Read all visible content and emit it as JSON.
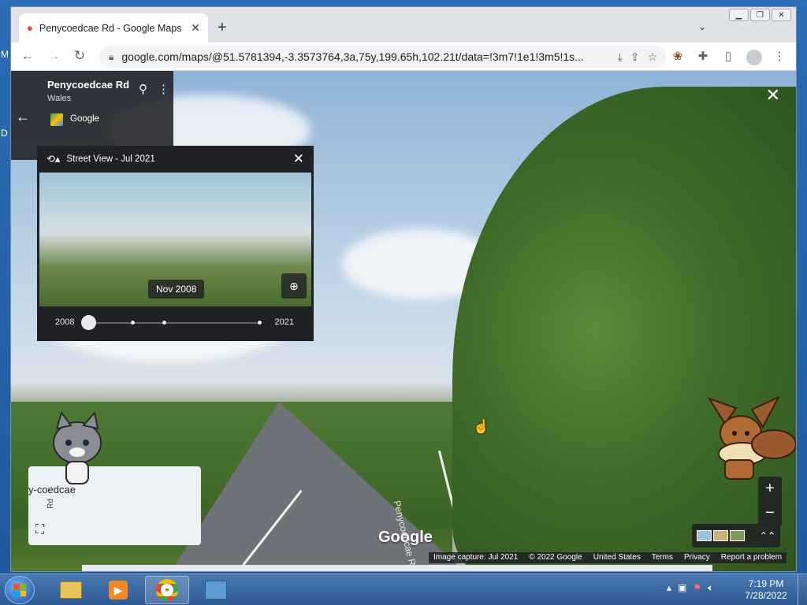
{
  "browser": {
    "tab_title": "Penycoedcae Rd - Google Maps",
    "url": "google.com/maps/@51.5781394,-3.3573764,3a,75y,199.65h,102.21t/data=!3m7!1e1!3m5!1s..."
  },
  "street_view": {
    "place_title": "Penycoedcae Rd",
    "place_subtitle": "Wales",
    "provider": "Google",
    "timeline": {
      "label": "Street View - Jul 2021",
      "selected_date": "Nov 2008",
      "start_year": "2008",
      "end_year": "2021"
    },
    "minimap": {
      "place_label": "y-coedcae",
      "road_label": "Rd"
    },
    "watermark": "Google",
    "road_marking": "Penycoedcae Rd",
    "attribution": [
      "Image capture: Jul 2021",
      "© 2022 Google",
      "United States",
      "Terms",
      "Privacy",
      "Report a problem"
    ]
  },
  "taskbar": {
    "clock_time": "7:19 PM",
    "clock_date": "7/28/2022"
  },
  "desktop": {
    "letters": [
      "M",
      "D"
    ]
  },
  "colors": {
    "panel_bg": "#202124",
    "taskbar": "#2d5a93",
    "accent_blue": "#4285f4"
  },
  "icons": [
    "maps-pin-icon",
    "close-icon",
    "plus-icon",
    "chevron-down-icon",
    "back-arrow-icon",
    "forward-arrow-icon",
    "reload-icon",
    "lock-icon",
    "install-icon",
    "share-icon",
    "star-icon",
    "paw-extension-icon",
    "puzzle-extension-icon",
    "sidepanel-icon",
    "profile-icon",
    "kebab-menu-icon",
    "history-icon",
    "zoom-in-icon",
    "expand-icon",
    "layers-expand-icon"
  ]
}
